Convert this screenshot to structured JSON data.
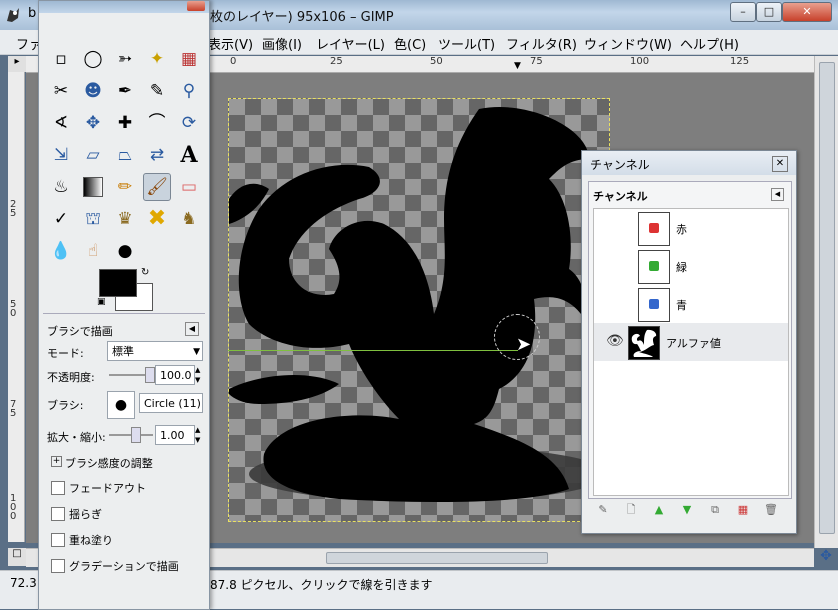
{
  "window": {
    "title": "b　　　　　　　　　　　　　　　　　　　　　　　　　　　　　　　　　",
    "title_visible": "枚のレイヤー) 95x106 – GIMP",
    "title_prefix": "b"
  },
  "menubar": {
    "items": [
      "ファ",
      "表示(V)",
      "画像(I)",
      "レイヤー(L)",
      "色(C)",
      "ツール(T)",
      "フィルタ(R)",
      "ウィンドウ(W)",
      "ヘルプ(H)"
    ]
  },
  "rulers": {
    "h_ticks": [
      "0",
      "25",
      "50",
      "75",
      "100",
      "125"
    ],
    "v_ticks": [
      "2 5",
      "5 0",
      "7 5",
      "1 0 0"
    ]
  },
  "status": {
    "left": "72.3",
    "message": "87.8 ピクセル、クリックで線を引きます"
  },
  "toolbox": {
    "tools": [
      "rect-select",
      "ellipse-select",
      "free-select",
      "fuzzy-select",
      "color-select",
      "scissors",
      "foreground-select",
      "paths",
      "color-picker",
      "zoom",
      "measure",
      "move",
      "align",
      "crop",
      "rotate",
      "scale",
      "shear",
      "perspective",
      "flip",
      "text",
      "bucket-fill",
      "blend",
      "pencil",
      "paintbrush",
      "eraser",
      "airbrush",
      "ink",
      "clone",
      "heal",
      "perspective-clone",
      "blur",
      "smudge",
      "dodge-burn"
    ],
    "options_title": "ブラシで描画",
    "mode_label": "モード:",
    "mode_value": "標準",
    "opacity_label": "不透明度:",
    "opacity_value": "100.0",
    "opacity": 1.0,
    "brush_label": "ブラシ:",
    "brush_value": "Circle (11)",
    "scale_label": "拡大・縮小:",
    "scale_value": "1.00",
    "dynamics_label": "ブラシ感度の調整",
    "checkboxes": [
      "フェードアウト",
      "揺らぎ",
      "重ね塗り",
      "グラデーションで描画"
    ],
    "fg_color": "#000000",
    "bg_color": "#ffffff"
  },
  "channels": {
    "window_title": "チャンネル",
    "tab_title": "チャンネル",
    "rows": [
      {
        "name": "赤",
        "color": "#d33"
      },
      {
        "name": "緑",
        "color": "#3a3"
      },
      {
        "name": "青",
        "color": "#36c"
      },
      {
        "name": "アルファ値",
        "color": "#000"
      }
    ]
  },
  "colors": {
    "selection": "#e9e060",
    "guide": "#7fbf3f"
  }
}
